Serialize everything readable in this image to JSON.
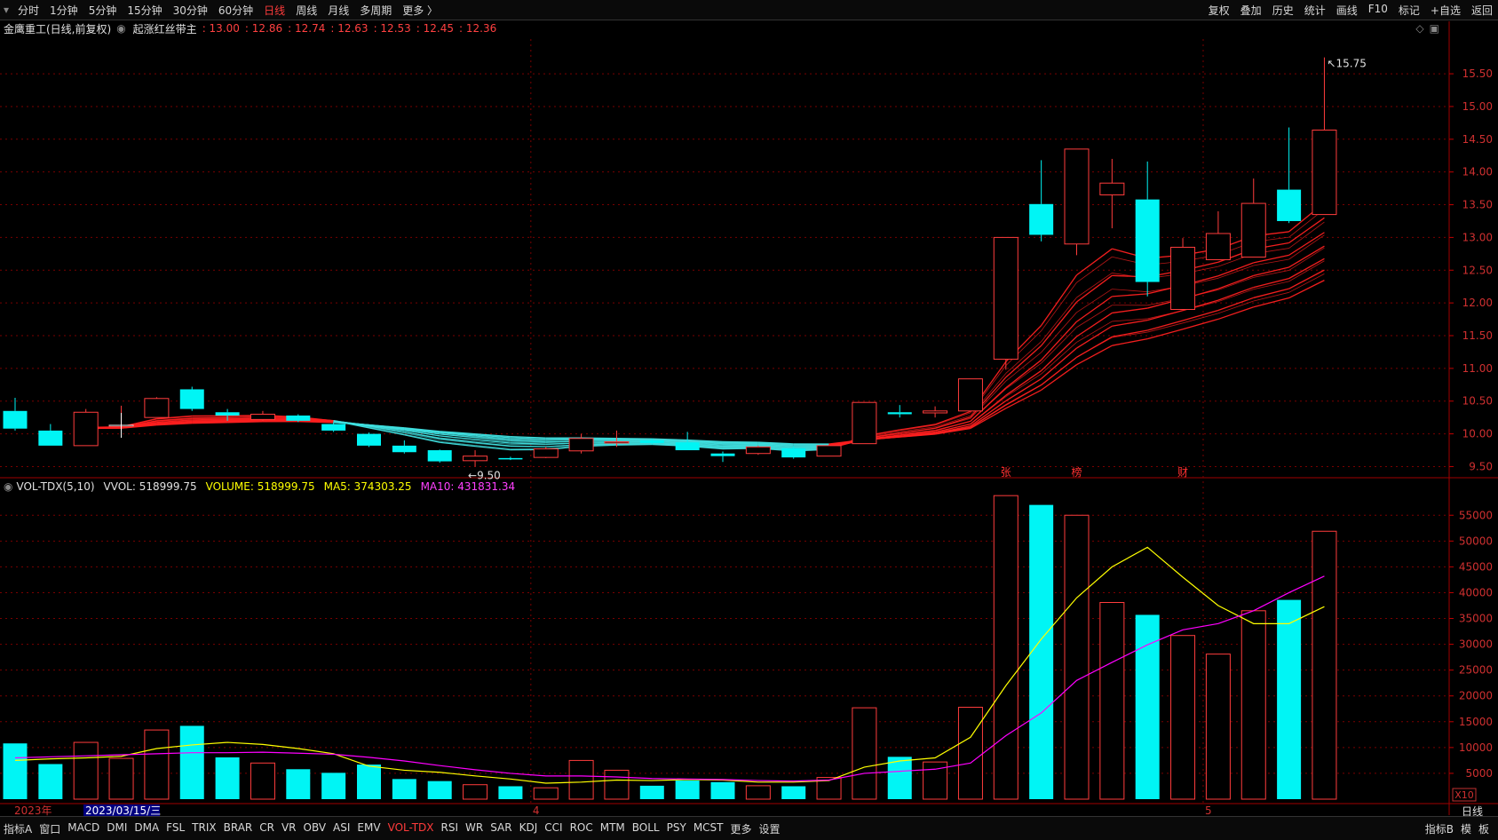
{
  "toolbar": {
    "periods": [
      "分时",
      "1分钟",
      "5分钟",
      "15分钟",
      "30分钟",
      "60分钟",
      "日线",
      "周线",
      "月线",
      "多周期",
      "更多 〉"
    ],
    "active_period": "日线",
    "right_tools": [
      "复权",
      "叠加",
      "历史",
      "统计",
      "画线",
      "F10",
      "标记",
      "+自选",
      "返回"
    ]
  },
  "info": {
    "stock": "金鹰重工(日线,前复权)",
    "indicator": "起涨红丝带主",
    "values": [
      ": 13.00",
      ": 12.86",
      ": 12.74",
      ": 12.63",
      ": 12.53",
      ": 12.45",
      ": 12.36"
    ]
  },
  "volume_header": {
    "name": "VOL-TDX(5,10)",
    "vvol": "VVOL: 518999.75",
    "volume": "VOLUME: 518999.75",
    "ma5": "MA5: 374303.25",
    "ma10": "MA10: 431831.34"
  },
  "colors": {
    "up": "#ff3c3c",
    "down": "#00f5f5",
    "ma5": "#ffff00",
    "ma10": "#ff00ff",
    "ribbon_up": "#ff2020",
    "ribbon_down": "#40e0e0",
    "grid": "#7a0000"
  },
  "chart_data": {
    "type": "candlestick",
    "price_axis": {
      "ticks": [
        9.5,
        10.0,
        10.5,
        11.0,
        11.5,
        12.0,
        12.5,
        13.0,
        13.5,
        14.0,
        14.5,
        15.0,
        15.5
      ],
      "range": [
        9.33,
        16.03
      ]
    },
    "volume_axis": {
      "ticks": [
        5000,
        10000,
        15000,
        20000,
        25000,
        30000,
        35000,
        40000,
        45000,
        50000,
        55000
      ],
      "multiplier": "X10",
      "range": [
        0,
        59000
      ]
    },
    "candles": [
      {
        "o": 10.35,
        "h": 10.55,
        "l": 10.05,
        "c": 10.08
      },
      {
        "o": 10.05,
        "h": 10.15,
        "l": 9.82,
        "c": 9.82
      },
      {
        "o": 9.82,
        "h": 10.38,
        "l": 9.82,
        "c": 10.33
      },
      {
        "o": 10.13,
        "h": 10.43,
        "l": 10.05,
        "c": 10.13
      },
      {
        "o": 10.25,
        "h": 10.56,
        "l": 10.25,
        "c": 10.54
      },
      {
        "o": 10.68,
        "h": 10.72,
        "l": 10.35,
        "c": 10.38
      },
      {
        "o": 10.33,
        "h": 10.38,
        "l": 10.2,
        "c": 10.28
      },
      {
        "o": 10.22,
        "h": 10.35,
        "l": 10.2,
        "c": 10.3
      },
      {
        "o": 10.28,
        "h": 10.3,
        "l": 10.18,
        "c": 10.2
      },
      {
        "o": 10.15,
        "h": 10.18,
        "l": 10.03,
        "c": 10.05
      },
      {
        "o": 10.0,
        "h": 10.02,
        "l": 9.8,
        "c": 9.82
      },
      {
        "o": 9.82,
        "h": 9.9,
        "l": 9.7,
        "c": 9.72
      },
      {
        "o": 9.75,
        "h": 9.76,
        "l": 9.56,
        "c": 9.58
      },
      {
        "o": 9.59,
        "h": 9.75,
        "l": 9.5,
        "c": 9.66
      },
      {
        "o": 9.63,
        "h": 9.65,
        "l": 9.6,
        "c": 9.62
      },
      {
        "o": 9.64,
        "h": 9.8,
        "l": 9.63,
        "c": 9.77
      },
      {
        "o": 9.74,
        "h": 10.0,
        "l": 9.7,
        "c": 9.93
      },
      {
        "o": 9.86,
        "h": 10.05,
        "l": 9.8,
        "c": 9.88
      },
      {
        "o": 9.9,
        "h": 9.93,
        "l": 9.84,
        "c": 9.86
      },
      {
        "o": 9.87,
        "h": 10.03,
        "l": 9.75,
        "c": 9.75
      },
      {
        "o": 9.7,
        "h": 9.73,
        "l": 9.57,
        "c": 9.66
      },
      {
        "o": 9.7,
        "h": 9.82,
        "l": 9.68,
        "c": 9.8
      },
      {
        "o": 9.78,
        "h": 9.81,
        "l": 9.62,
        "c": 9.64
      },
      {
        "o": 9.66,
        "h": 9.84,
        "l": 9.66,
        "c": 9.82
      },
      {
        "o": 9.85,
        "h": 10.48,
        "l": 9.85,
        "c": 10.48
      },
      {
        "o": 10.33,
        "h": 10.44,
        "l": 10.25,
        "c": 10.3
      },
      {
        "o": 10.32,
        "h": 10.42,
        "l": 10.25,
        "c": 10.35
      },
      {
        "o": 10.35,
        "h": 10.84,
        "l": 10.35,
        "c": 10.84
      },
      {
        "o": 11.14,
        "h": 13.0,
        "l": 10.98,
        "c": 13.0
      },
      {
        "o": 13.51,
        "h": 14.18,
        "l": 12.94,
        "c": 13.04
      },
      {
        "o": 12.9,
        "h": 14.35,
        "l": 12.73,
        "c": 14.35
      },
      {
        "o": 13.65,
        "h": 14.2,
        "l": 13.14,
        "c": 13.83
      },
      {
        "o": 13.58,
        "h": 14.16,
        "l": 12.1,
        "c": 12.32
      },
      {
        "o": 11.9,
        "h": 12.99,
        "l": 11.9,
        "c": 12.85
      },
      {
        "o": 12.66,
        "h": 13.4,
        "l": 12.66,
        "c": 13.06
      },
      {
        "o": 12.7,
        "h": 13.9,
        "l": 12.7,
        "c": 13.52
      },
      {
        "o": 13.73,
        "h": 14.68,
        "l": 13.22,
        "c": 13.25
      },
      {
        "o": 13.35,
        "h": 15.75,
        "l": 13.35,
        "c": 14.64
      }
    ],
    "volumes": [
      10800,
      6800,
      11000,
      7900,
      13400,
      14200,
      8100,
      7000,
      5800,
      5100,
      6700,
      3900,
      3500,
      2800,
      2500,
      2200,
      7500,
      5600,
      2600,
      3600,
      3300,
      2600,
      2500,
      4200,
      17700,
      8200,
      7200,
      17800,
      58800,
      57000,
      55000,
      38100,
      35700,
      31700,
      28100,
      36500,
      38600,
      51900
    ],
    "ma5": [
      7500,
      7800,
      8000,
      8300,
      9800,
      10500,
      11000,
      10600,
      9800,
      8800,
      6400,
      5600,
      5200,
      4500,
      3900,
      3100,
      3300,
      3700,
      3600,
      3800,
      3700,
      3300,
      3300,
      3600,
      6200,
      7400,
      8000,
      12000,
      22000,
      31000,
      39000,
      45000,
      48800,
      43000,
      37500,
      34000,
      34000,
      37300
    ],
    "ma10": [
      8000,
      8200,
      8400,
      8600,
      8800,
      9000,
      9000,
      9100,
      8900,
      8700,
      8100,
      7400,
      6500,
      5700,
      5000,
      4500,
      4500,
      4300,
      4000,
      3900,
      3800,
      3600,
      3500,
      3700,
      5000,
      5400,
      5800,
      7000,
      12300,
      16700,
      23000,
      26500,
      29900,
      32800,
      34000,
      36500,
      40000,
      43200
    ],
    "ribbon_values_last": [
      13.0,
      12.86,
      12.74,
      12.63,
      12.53,
      12.45,
      12.36
    ],
    "annotations": [
      {
        "text": "15.75",
        "index": 37
      },
      {
        "text": "←9.50",
        "index": 13
      }
    ],
    "event_markers": [
      {
        "text": "张",
        "index": 28
      },
      {
        "text": "榜",
        "index": 30
      },
      {
        "text": "财",
        "index": 33
      }
    ],
    "x_labels": [
      {
        "text": "2023年",
        "index": 0
      },
      {
        "text": "2023/03/15/三",
        "index": 2
      },
      {
        "text": "4",
        "index": 15
      },
      {
        "text": "5",
        "index": 34
      }
    ],
    "right_labels": {
      "multiplier": "X10",
      "period": "日线"
    }
  },
  "bottom_tabs": [
    "指标A",
    "窗口",
    "MACD",
    "DMI",
    "DMA",
    "FSL",
    "TRIX",
    "BRAR",
    "CR",
    "VR",
    "OBV",
    "ASI",
    "EMV",
    "VOL-TDX",
    "RSI",
    "WR",
    "SAR",
    "KDJ",
    "CCI",
    "ROC",
    "MTM",
    "BOLL",
    "PSY",
    "MCST",
    "更多",
    "设置"
  ],
  "active_tab": "VOL-TDX",
  "bottom_right": [
    "指标B",
    "模",
    "板"
  ]
}
